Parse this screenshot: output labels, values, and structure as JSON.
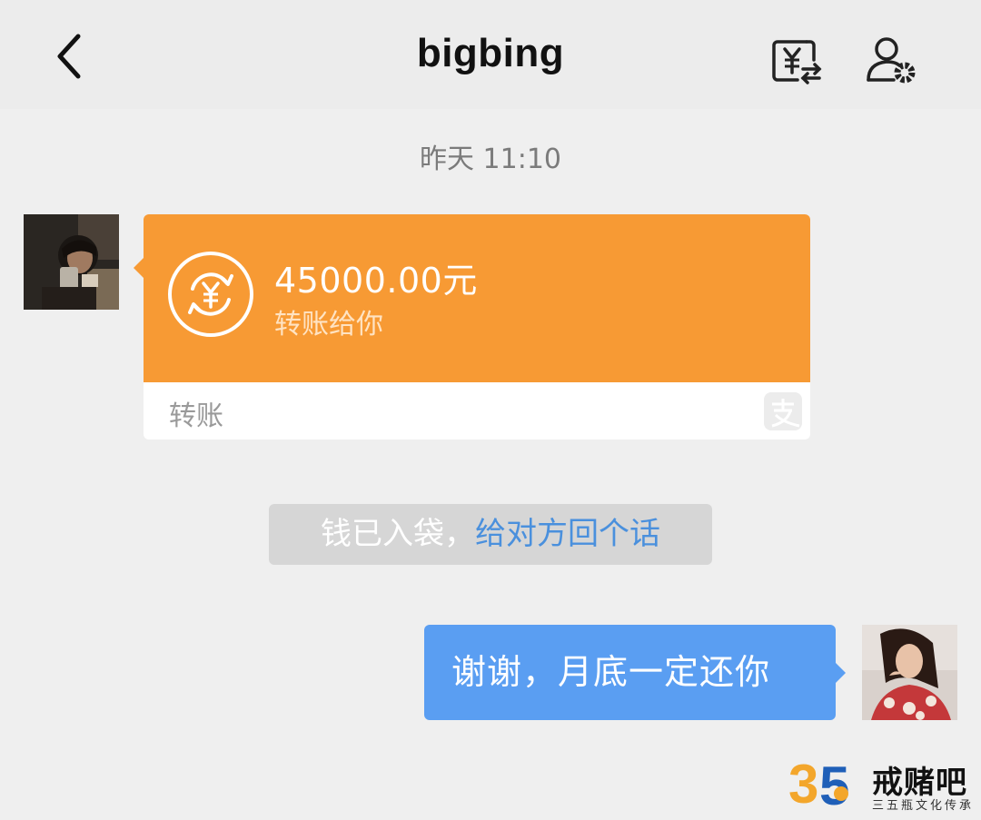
{
  "header": {
    "title": "bigbing",
    "back_icon": "chevron-left-icon",
    "transfer_icon": "yuan-transfer-icon",
    "profile_icon": "user-settings-icon"
  },
  "timestamp": "昨天 11:10",
  "transfer_card": {
    "amount": "45000.00元",
    "subtitle": "转账给你",
    "footer_label": "转账",
    "icon": "yuan-exchange-icon",
    "brand_icon": "alipay-icon",
    "color": "#f79a34"
  },
  "notice": {
    "text": "钱已入袋，",
    "link": "给对方回个话"
  },
  "outgoing_message": {
    "text": "谢谢，月底一定还你",
    "color": "#5a9ef2"
  },
  "watermark": {
    "logo_text": "35",
    "name": "戒赌吧",
    "subtitle": "三五瓶文化传承"
  }
}
